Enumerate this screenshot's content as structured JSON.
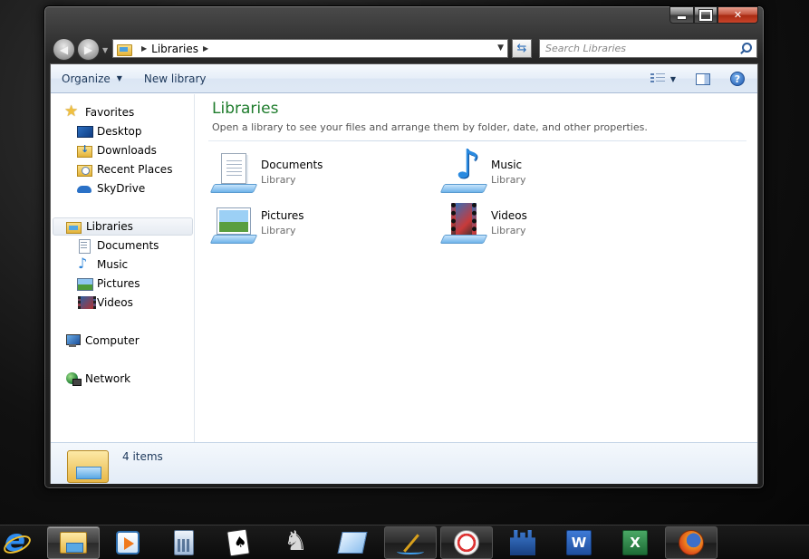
{
  "window": {
    "address": {
      "segments": [
        "Libraries"
      ]
    },
    "search": {
      "placeholder": "Search Libraries"
    },
    "toolbar": {
      "organize_label": "Organize",
      "new_library_label": "New library",
      "help_label": "?"
    },
    "navpane": {
      "favorites": {
        "label": "Favorites",
        "items": [
          {
            "label": "Desktop",
            "icon": "desktop-icon"
          },
          {
            "label": "Downloads",
            "icon": "downloads-folder-icon"
          },
          {
            "label": "Recent Places",
            "icon": "recent-places-icon"
          },
          {
            "label": "SkyDrive",
            "icon": "skydrive-cloud-icon"
          }
        ]
      },
      "libraries": {
        "label": "Libraries",
        "selected": true,
        "items": [
          {
            "label": "Documents",
            "icon": "documents-library-icon"
          },
          {
            "label": "Music",
            "icon": "music-library-icon"
          },
          {
            "label": "Pictures",
            "icon": "pictures-library-icon"
          },
          {
            "label": "Videos",
            "icon": "videos-library-icon"
          }
        ]
      },
      "computer": {
        "label": "Computer"
      },
      "network": {
        "label": "Network"
      }
    },
    "content": {
      "title": "Libraries",
      "subtitle": "Open a library to see your files and arrange them by folder, date, and other properties.",
      "tiles": [
        {
          "name": "Documents",
          "type": "Library"
        },
        {
          "name": "Music",
          "type": "Library"
        },
        {
          "name": "Pictures",
          "type": "Library"
        },
        {
          "name": "Videos",
          "type": "Library"
        }
      ]
    },
    "details": {
      "count_text": "4 items"
    }
  },
  "taskbar": {
    "items": [
      {
        "icon": "internet-explorer-icon"
      },
      {
        "icon": "windows-explorer-icon",
        "active": true
      },
      {
        "icon": "windows-media-player-icon"
      },
      {
        "icon": "calculator-icon"
      },
      {
        "icon": "solitaire-icon"
      },
      {
        "icon": "chess-icon"
      },
      {
        "icon": "sticky-notes-icon"
      },
      {
        "icon": "pen-app-icon",
        "running": true
      },
      {
        "icon": "snipping-tool-icon",
        "running": true
      },
      {
        "icon": "castle-app-icon"
      },
      {
        "icon": "word-icon",
        "label": "W"
      },
      {
        "icon": "excel-icon",
        "label": "X"
      },
      {
        "icon": "firefox-icon",
        "running": true
      }
    ]
  },
  "colors": {
    "title_green": "#1e7c2c",
    "toolbar_text": "#1e395b",
    "close_red": "#c14f38"
  }
}
